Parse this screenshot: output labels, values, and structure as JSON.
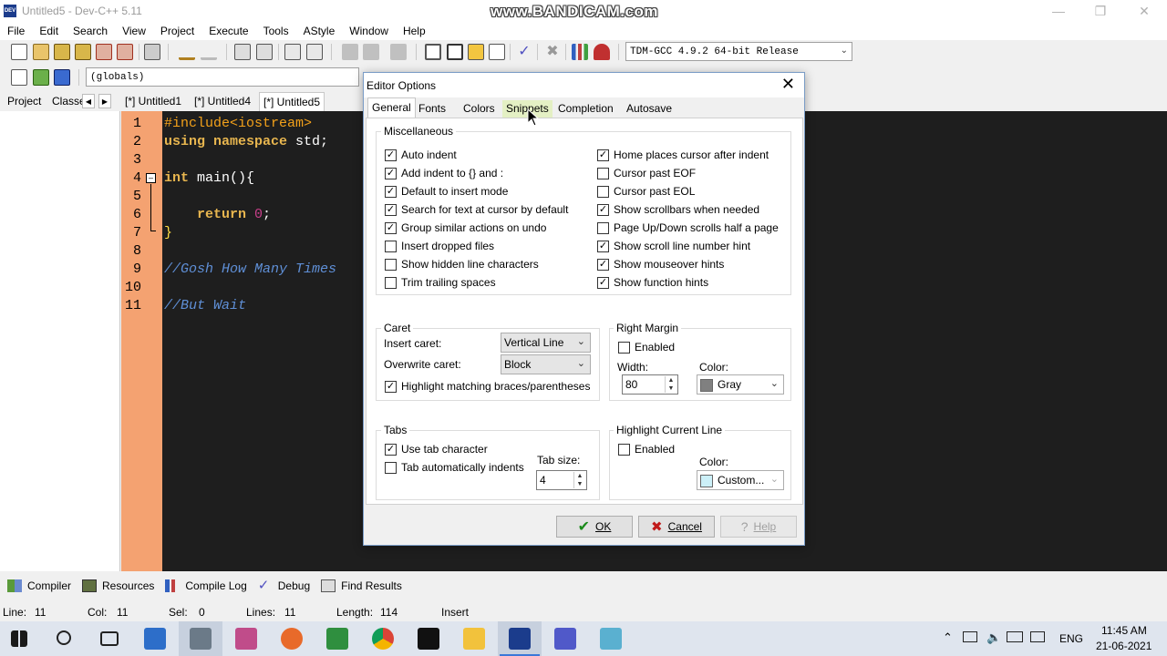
{
  "window": {
    "title": "Untitled5 - Dev-C++ 5.11",
    "watermark": "www.BANDICAM.com",
    "app_icon_text": "DEV"
  },
  "menu": [
    "File",
    "Edit",
    "Search",
    "View",
    "Project",
    "Execute",
    "Tools",
    "AStyle",
    "Window",
    "Help"
  ],
  "toolbar": {
    "compiler_select": "TDM-GCC 4.9.2 64-bit Release",
    "scope_select": "(globals)"
  },
  "panels": {
    "left_tabs": [
      "Project",
      "Classe"
    ],
    "editor_tabs": [
      "[*] Untitled1",
      "[*] Untitled4",
      "[*] Untitled5"
    ]
  },
  "editor": {
    "line_numbers": [
      "1",
      "2",
      "3",
      "4",
      "5",
      "6",
      "7",
      "8",
      "9",
      "10",
      "11"
    ],
    "line1": "#include<iostream>",
    "line2_kw": "using namespace",
    "line2_id": " std;",
    "line4_kw": "int",
    "line4_id": " main(){",
    "line6_kw": "return",
    "line6_num": "0",
    "line6_end": ";",
    "line7": "}",
    "line9": "//Gosh How Many Times",
    "line11": "//But Wait"
  },
  "bottom_tabs": [
    "Compiler",
    "Resources",
    "Compile Log",
    "Debug",
    "Find Results"
  ],
  "status": {
    "line_label": "Line:",
    "line": "11",
    "col_label": "Col:",
    "col": "11",
    "sel_label": "Sel:",
    "sel": "0",
    "lines_label": "Lines:",
    "lines": "11",
    "length_label": "Length:",
    "length": "114",
    "mode": "Insert"
  },
  "taskbar": {
    "lang": "ENG",
    "time": "11:45 AM",
    "date": "21-06-2021"
  },
  "dialog": {
    "title": "Editor Options",
    "tabs": [
      "General",
      "Fonts",
      "Colors",
      "Snippets",
      "Completion",
      "Autosave"
    ],
    "misc_title": "Miscellaneous",
    "misc_left": [
      {
        "label": "Auto indent",
        "checked": true
      },
      {
        "label": "Add indent to {} and :",
        "checked": true
      },
      {
        "label": "Default to insert mode",
        "checked": true
      },
      {
        "label": "Search for text at cursor by default",
        "checked": true
      },
      {
        "label": "Group similar actions on undo",
        "checked": true
      },
      {
        "label": "Insert dropped files",
        "checked": false
      },
      {
        "label": "Show hidden line characters",
        "checked": false
      },
      {
        "label": "Trim trailing spaces",
        "checked": false
      }
    ],
    "misc_right": [
      {
        "label": "Home places cursor after indent",
        "checked": true
      },
      {
        "label": "Cursor past EOF",
        "checked": false
      },
      {
        "label": "Cursor past EOL",
        "checked": false
      },
      {
        "label": "Show scrollbars when needed",
        "checked": true
      },
      {
        "label": "Page Up/Down scrolls half a page",
        "checked": false
      },
      {
        "label": "Show scroll line number hint",
        "checked": true
      },
      {
        "label": "Show mouseover hints",
        "checked": true
      },
      {
        "label": "Show function hints",
        "checked": true
      }
    ],
    "caret": {
      "title": "Caret",
      "insert_label": "Insert caret:",
      "insert_value": "Vertical Line",
      "overwrite_label": "Overwrite caret:",
      "overwrite_value": "Block",
      "highlight_label": "Highlight matching braces/parentheses",
      "highlight_checked": true
    },
    "right_margin": {
      "title": "Right Margin",
      "enabled_label": "Enabled",
      "enabled": false,
      "width_label": "Width:",
      "width_value": "80",
      "color_label": "Color:",
      "color_value": "Gray",
      "color_hex": "#808080"
    },
    "tabs_group": {
      "title": "Tabs",
      "use_tab_label": "Use tab character",
      "use_tab": true,
      "auto_indent_label": "Tab automatically indents",
      "auto_indent": false,
      "size_label": "Tab size:",
      "size_value": "4"
    },
    "highlight_line": {
      "title": "Highlight Current Line",
      "enabled_label": "Enabled",
      "enabled": false,
      "color_label": "Color:",
      "color_value": "Custom...",
      "color_hex": "#ccf0f8"
    },
    "buttons": {
      "ok": "OK",
      "cancel": "Cancel",
      "help": "Help"
    }
  }
}
